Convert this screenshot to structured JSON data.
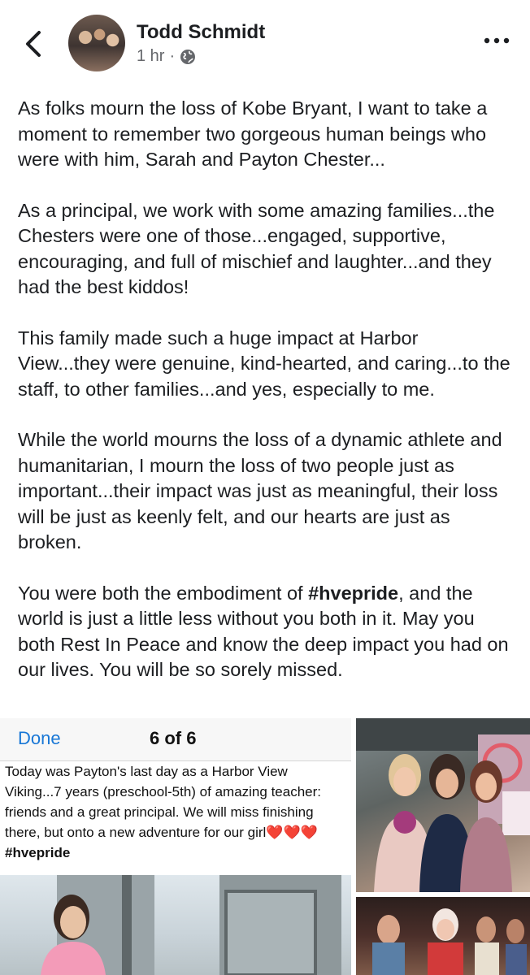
{
  "header": {
    "author": "Todd Schmidt",
    "timestamp": "1 hr",
    "separator": "·",
    "back_icon": "chevron-left-icon",
    "audience_icon": "globe-icon",
    "more_icon": "more-horizontal-icon"
  },
  "post": {
    "paragraphs": [
      "As folks mourn the loss of Kobe Bryant, I want to take a moment to remember two gorgeous human beings who were with him, Sarah and Payton Chester...",
      "As a principal, we work with some amazing families...the Chesters were one of those...engaged, supportive, encouraging, and full of mischief and laughter...and they had the best kiddos!",
      "This family made such a huge impact at Harbor View...they were genuine, kind-hearted, and caring...to the staff, to other families...and yes, especially to me.",
      "While the world mourns the loss of a dynamic athlete and humanitarian, I mourn the loss of two people just as important...their impact was just as meaningful, their loss will be just as keenly felt, and our hearts are just as broken."
    ],
    "last_paragraph": {
      "before": "You were both the embodiment of ",
      "hashtag": "#hvepride",
      "after": ", and the world is just a little less without you both in it.  May you both Rest In Peace and know the deep impact you had on our lives.  You will be so sorely missed."
    }
  },
  "photos": {
    "screenshot": {
      "done_label": "Done",
      "count_label": "6 of 6",
      "caption": "Today was Payton's last day as a Harbor View Viking...7 years (preschool-5th) of amazing teacher: friends and a great principal. We will miss finishing there, but onto a new adventure for our girl",
      "hearts": "❤️❤️❤️",
      "hashtag": "#hvepride"
    }
  },
  "colors": {
    "link_blue": "#1877d6",
    "text": "#1c1e21",
    "meta_gray": "#65676b"
  }
}
